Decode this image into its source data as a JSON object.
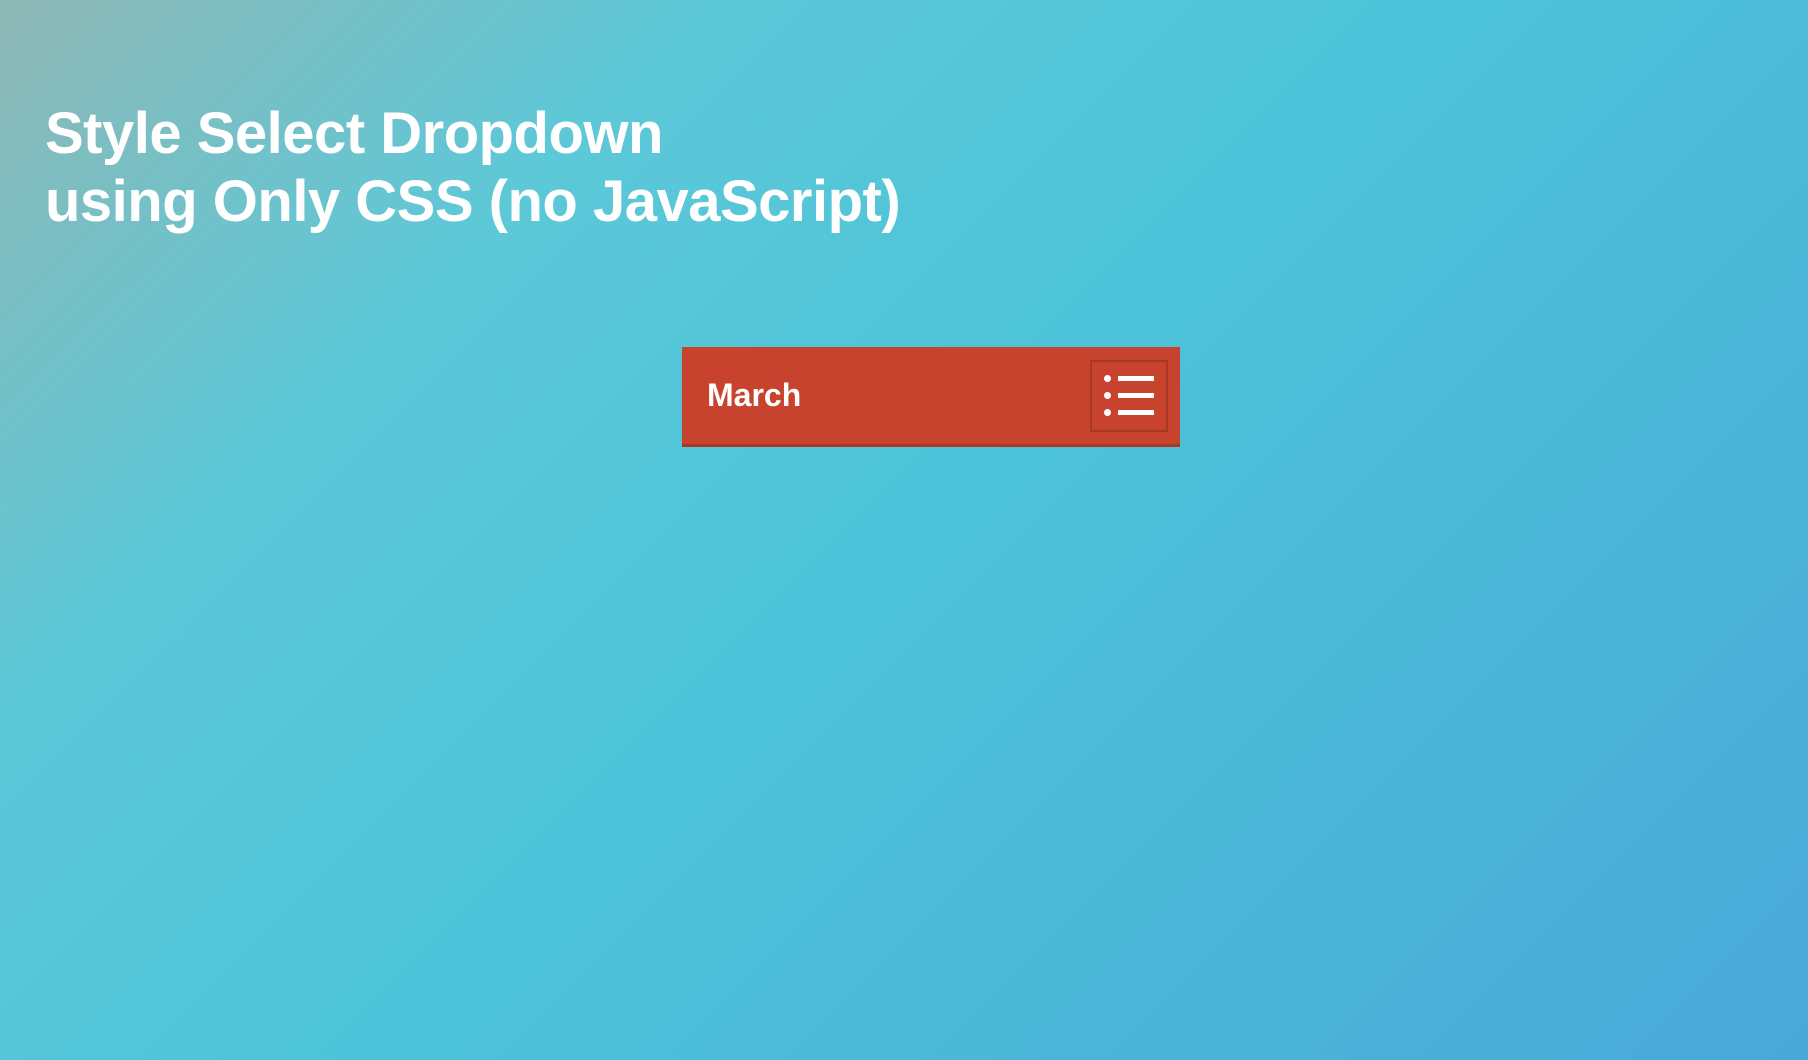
{
  "heading": {
    "line1": "Style Select Dropdown",
    "line2": "using Only CSS (no JavaScript)"
  },
  "select": {
    "selected_value": "March",
    "icon_name": "list-icon"
  },
  "colors": {
    "background_gradient_start": "#8fb8b5",
    "background_gradient_end": "#4aa8d8",
    "select_bg": "#c7432e",
    "select_border": "#a83826",
    "text": "#ffffff"
  }
}
